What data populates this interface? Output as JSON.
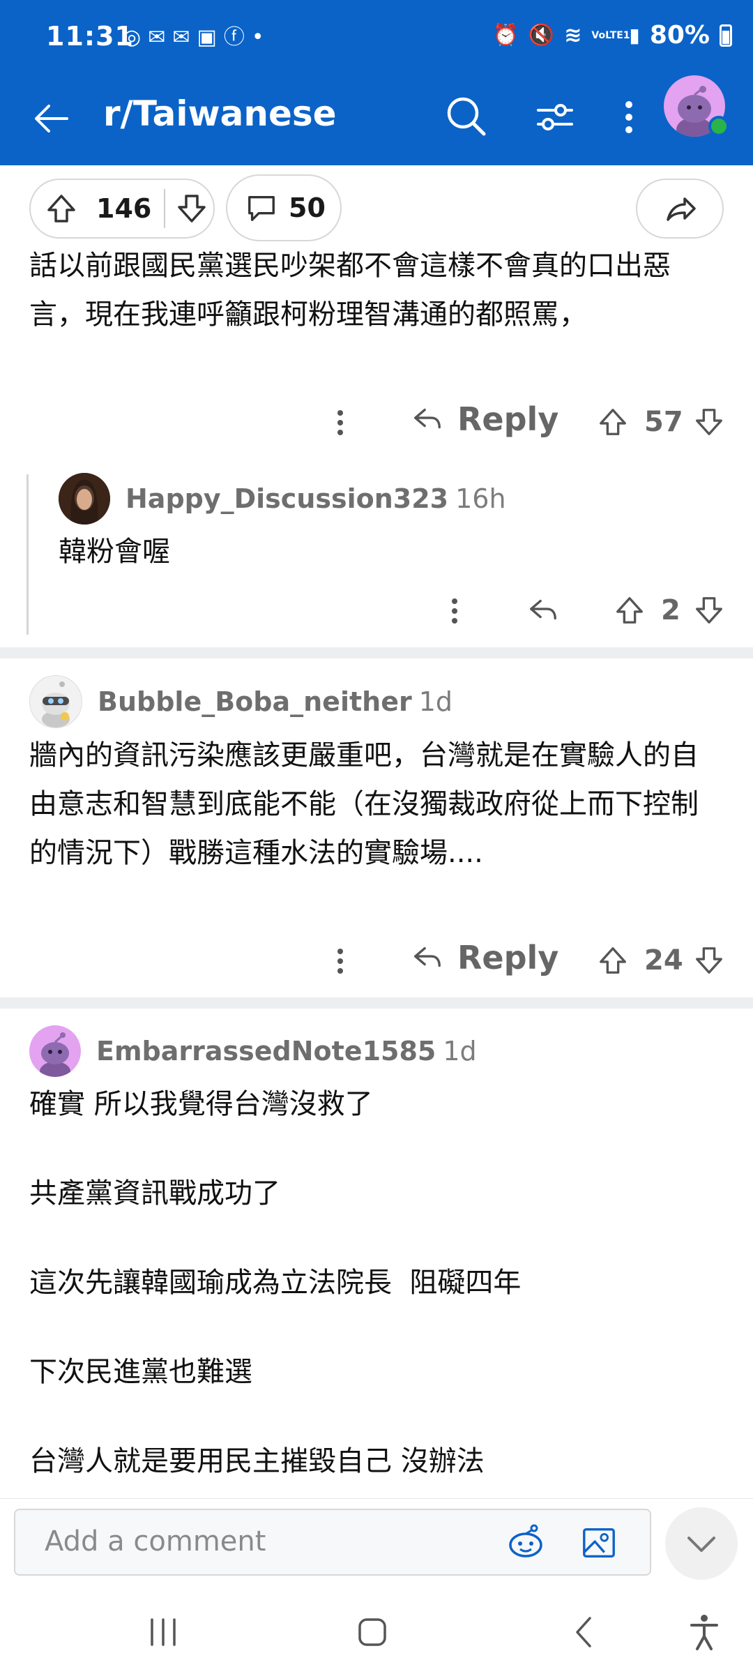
{
  "status": {
    "time": "11:31",
    "battery": "80%",
    "network": "VoLTE1"
  },
  "header": {
    "title": "r/Taiwanese"
  },
  "post": {
    "score": "146",
    "comments": "50"
  },
  "comments": [
    {
      "text": "話以前跟國民黨選民吵架都不會這樣不會真的口出惡言，現在我連呼籲跟柯粉理智溝通的都照罵，",
      "reply_label": "Reply",
      "score": "57",
      "reply": {
        "username": "Happy_Discussion323",
        "time": "16h",
        "text": "韓粉會喔",
        "score": "2"
      }
    },
    {
      "username": "Bubble_Boba_neither",
      "time": "1d",
      "text": "牆內的資訊污染應該更嚴重吧，台灣就是在實驗人的自由意志和智慧到底能不能（在沒獨裁政府從上而下控制的情況下）戰勝這種水法的實驗場....",
      "reply_label": "Reply",
      "score": "24"
    },
    {
      "username": "EmbarrassedNote1585",
      "time": "1d",
      "lines": [
        "確實 所以我覺得台灣沒救了",
        "共產黨資訊戰成功了",
        "這次先讓韓國瑜成為立法院長  阻礙四年",
        "下次民進黨也難選",
        "台灣人就是要用民主摧毀自己 沒辦法"
      ]
    }
  ],
  "composer": {
    "placeholder": "Add a comment"
  },
  "colors": {
    "brand": "#0b63c8",
    "online": "#29b34a",
    "avatar": "#e3a3f0"
  }
}
